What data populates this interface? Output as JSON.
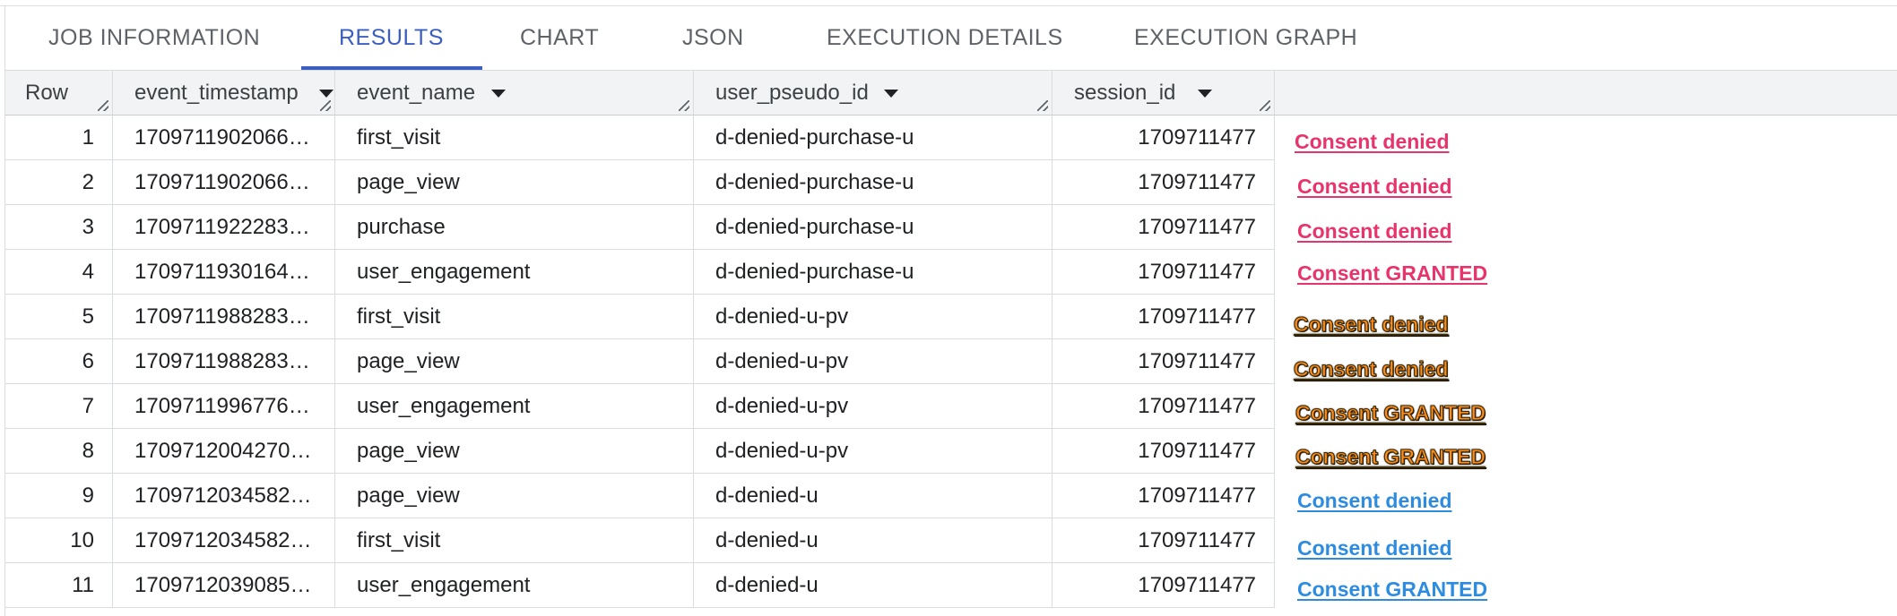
{
  "tabs": [
    {
      "label": "JOB INFORMATION",
      "active": false
    },
    {
      "label": "RESULTS",
      "active": true
    },
    {
      "label": "CHART",
      "active": false
    },
    {
      "label": "JSON",
      "active": false
    },
    {
      "label": "EXECUTION DETAILS",
      "active": false
    },
    {
      "label": "EXECUTION GRAPH",
      "active": false
    }
  ],
  "table": {
    "columns": [
      "Row",
      "event_timestamp",
      "event_name",
      "user_pseudo_id",
      "session_id"
    ],
    "rows": [
      {
        "row": "1",
        "event_timestamp": "1709711902066…",
        "event_name": "first_visit",
        "user_pseudo_id": "d-denied-purchase-u",
        "session_id": "1709711477"
      },
      {
        "row": "2",
        "event_timestamp": "1709711902066…",
        "event_name": "page_view",
        "user_pseudo_id": "d-denied-purchase-u",
        "session_id": "1709711477"
      },
      {
        "row": "3",
        "event_timestamp": "1709711922283…",
        "event_name": "purchase",
        "user_pseudo_id": "d-denied-purchase-u",
        "session_id": "1709711477"
      },
      {
        "row": "4",
        "event_timestamp": "1709711930164…",
        "event_name": "user_engagement",
        "user_pseudo_id": "d-denied-purchase-u",
        "session_id": "1709711477"
      },
      {
        "row": "5",
        "event_timestamp": "1709711988283…",
        "event_name": "first_visit",
        "user_pseudo_id": "d-denied-u-pv",
        "session_id": "1709711477"
      },
      {
        "row": "6",
        "event_timestamp": "1709711988283…",
        "event_name": "page_view",
        "user_pseudo_id": "d-denied-u-pv",
        "session_id": "1709711477"
      },
      {
        "row": "7",
        "event_timestamp": "1709711996776…",
        "event_name": "user_engagement",
        "user_pseudo_id": "d-denied-u-pv",
        "session_id": "1709711477"
      },
      {
        "row": "8",
        "event_timestamp": "1709712004270…",
        "event_name": "page_view",
        "user_pseudo_id": "d-denied-u-pv",
        "session_id": "1709711477"
      },
      {
        "row": "9",
        "event_timestamp": "1709712034582…",
        "event_name": "page_view",
        "user_pseudo_id": "d-denied-u",
        "session_id": "1709711477"
      },
      {
        "row": "10",
        "event_timestamp": "1709712034582…",
        "event_name": "first_visit",
        "user_pseudo_id": "d-denied-u",
        "session_id": "1709711477"
      },
      {
        "row": "11",
        "event_timestamp": "1709712039085…",
        "event_name": "user_engagement",
        "user_pseudo_id": "d-denied-u",
        "session_id": "1709711477"
      }
    ]
  },
  "annotations": [
    {
      "text": "Consent denied",
      "style": "pink",
      "color": "#e8336b"
    },
    {
      "text": "Consent denied",
      "style": "pink",
      "color": "#e8336b"
    },
    {
      "text": "Consent denied",
      "style": "pink",
      "color": "#e8336b"
    },
    {
      "text": "Consent GRANTED",
      "style": "pink",
      "color": "#e8336b"
    },
    {
      "text": "Consent denied",
      "style": "orange",
      "color": "#ff8c1a"
    },
    {
      "text": "Consent denied",
      "style": "orange",
      "color": "#ff8c1a"
    },
    {
      "text": "Consent GRANTED",
      "style": "orange",
      "color": "#ff8c1a"
    },
    {
      "text": "Consent GRANTED",
      "style": "orange",
      "color": "#ff8c1a"
    },
    {
      "text": "Consent denied",
      "style": "blue",
      "color": "#2d8ce0"
    },
    {
      "text": "Consent denied",
      "style": "blue",
      "color": "#2d8ce0"
    },
    {
      "text": "Consent GRANTED",
      "style": "blue",
      "color": "#2d8ce0"
    }
  ],
  "colors": {
    "accent": "#3b5fc0",
    "header_bg": "#f1f3f4",
    "border": "#dadce0"
  }
}
